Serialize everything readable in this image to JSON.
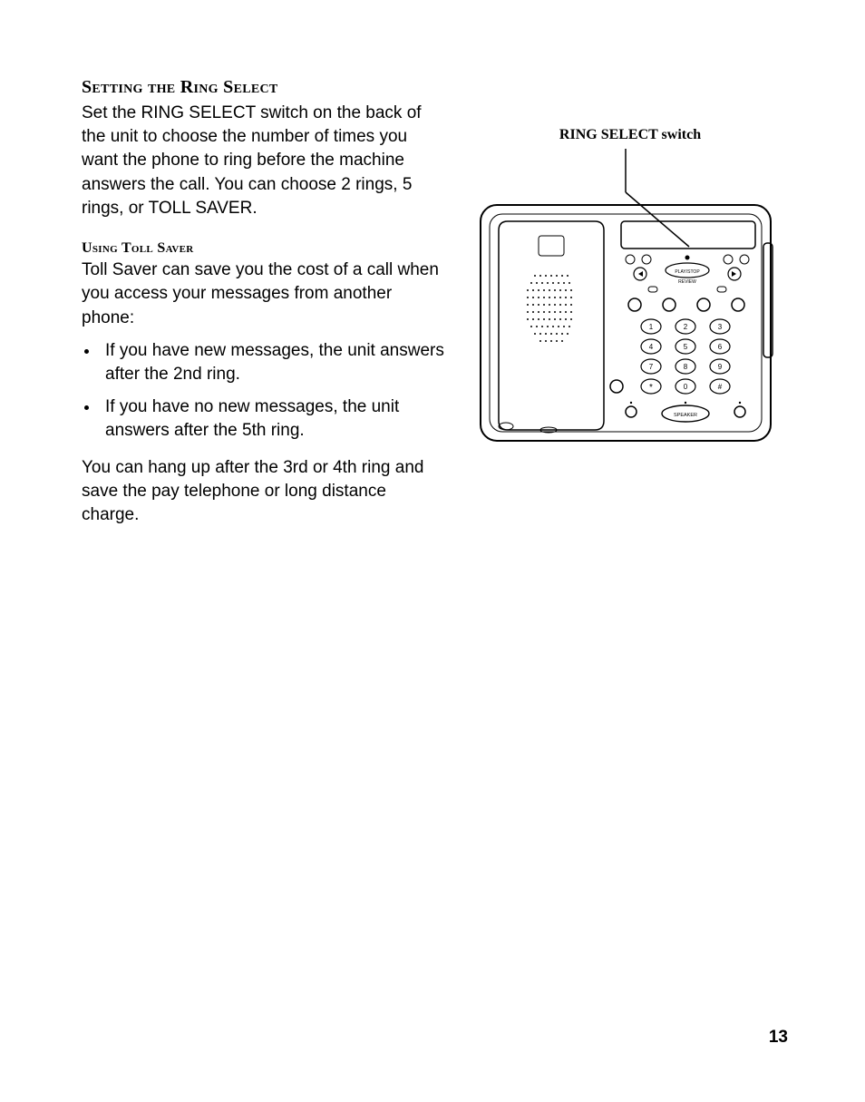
{
  "section": {
    "heading": "Setting the Ring Select",
    "intro": "Set the RING SELECT switch on the back of the unit to choose the number of times you want the phone to ring before the machine answers the call. You can choose 2 rings, 5 rings, or TOLL SAVER.",
    "subHeading": "Using Toll Saver",
    "subIntro": "Toll Saver can save you the cost of a call when you access your messages from another phone:",
    "bullets": [
      "If you have new messages, the unit answers after the 2nd ring.",
      "If you have no new messages, the unit answers after the 5th ring."
    ],
    "closing": "You can hang up after the 3rd or 4th ring and save the pay telephone or long distance charge."
  },
  "figure": {
    "caption": "RING SELECT switch",
    "labels": {
      "playStop": "PLAY/STOP",
      "review": "REVIEW",
      "speaker": "SPEAKER",
      "keypad": [
        "1",
        "2",
        "3",
        "4",
        "5",
        "6",
        "7",
        "8",
        "9",
        "*",
        "0",
        "#"
      ]
    }
  },
  "pageNumber": "13"
}
